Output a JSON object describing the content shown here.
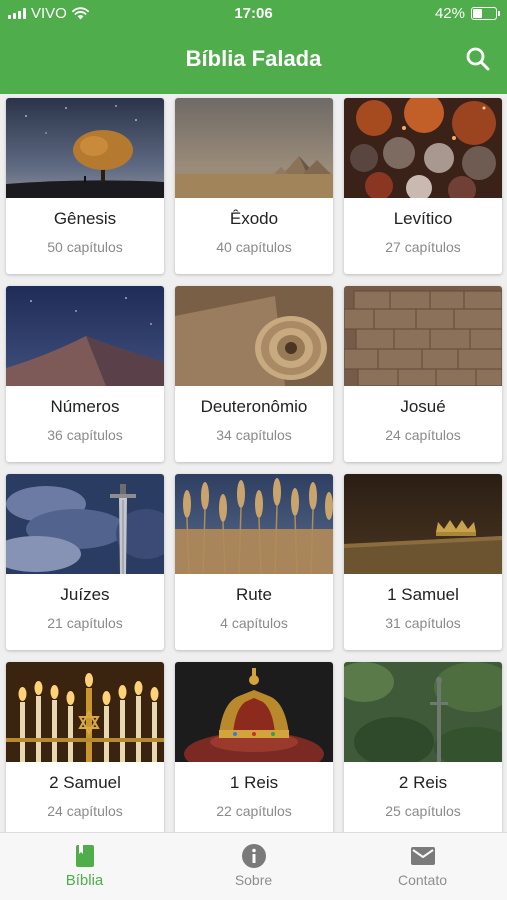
{
  "status_bar": {
    "carrier": "VIVO",
    "time": "17:06",
    "battery": "42%",
    "battery_level": 0.42
  },
  "header": {
    "title": "Bíblia Falada",
    "search_icon": "search-icon"
  },
  "books": [
    {
      "name": "Gênesis",
      "chapters": "50 capítulos",
      "image": "tree-under-starry-sky"
    },
    {
      "name": "Êxodo",
      "chapters": "40 capítulos",
      "image": "desert-pyramids"
    },
    {
      "name": "Levítico",
      "chapters": "27 capítulos",
      "image": "burning-coals"
    },
    {
      "name": "Números",
      "chapters": "36 capítulos",
      "image": "desert-dunes-night"
    },
    {
      "name": "Deuteronômio",
      "chapters": "34 capítulos",
      "image": "scroll"
    },
    {
      "name": "Josué",
      "chapters": "24 capítulos",
      "image": "stone-wall"
    },
    {
      "name": "Juízes",
      "chapters": "21 capítulos",
      "image": "sword-in-clouds"
    },
    {
      "name": "Rute",
      "chapters": "4 capítulos",
      "image": "wheat-field"
    },
    {
      "name": "1 Samuel",
      "chapters": "31 capítulos",
      "image": "crown-on-table"
    },
    {
      "name": "2 Samuel",
      "chapters": "24 capítulos",
      "image": "menorah-candles"
    },
    {
      "name": "1 Reis",
      "chapters": "22 capítulos",
      "image": "royal-crown"
    },
    {
      "name": "2 Reis",
      "chapters": "25 capítulos",
      "image": "sword-in-grass"
    }
  ],
  "tabs": [
    {
      "label": "Bíblia",
      "icon": "book-icon",
      "active": true
    },
    {
      "label": "Sobre",
      "icon": "info-icon",
      "active": false
    },
    {
      "label": "Contato",
      "icon": "mail-icon",
      "active": false
    }
  ],
  "colors": {
    "primary": "#4fae4b",
    "tab_inactive": "#8e8e8e",
    "background": "#efefef"
  }
}
